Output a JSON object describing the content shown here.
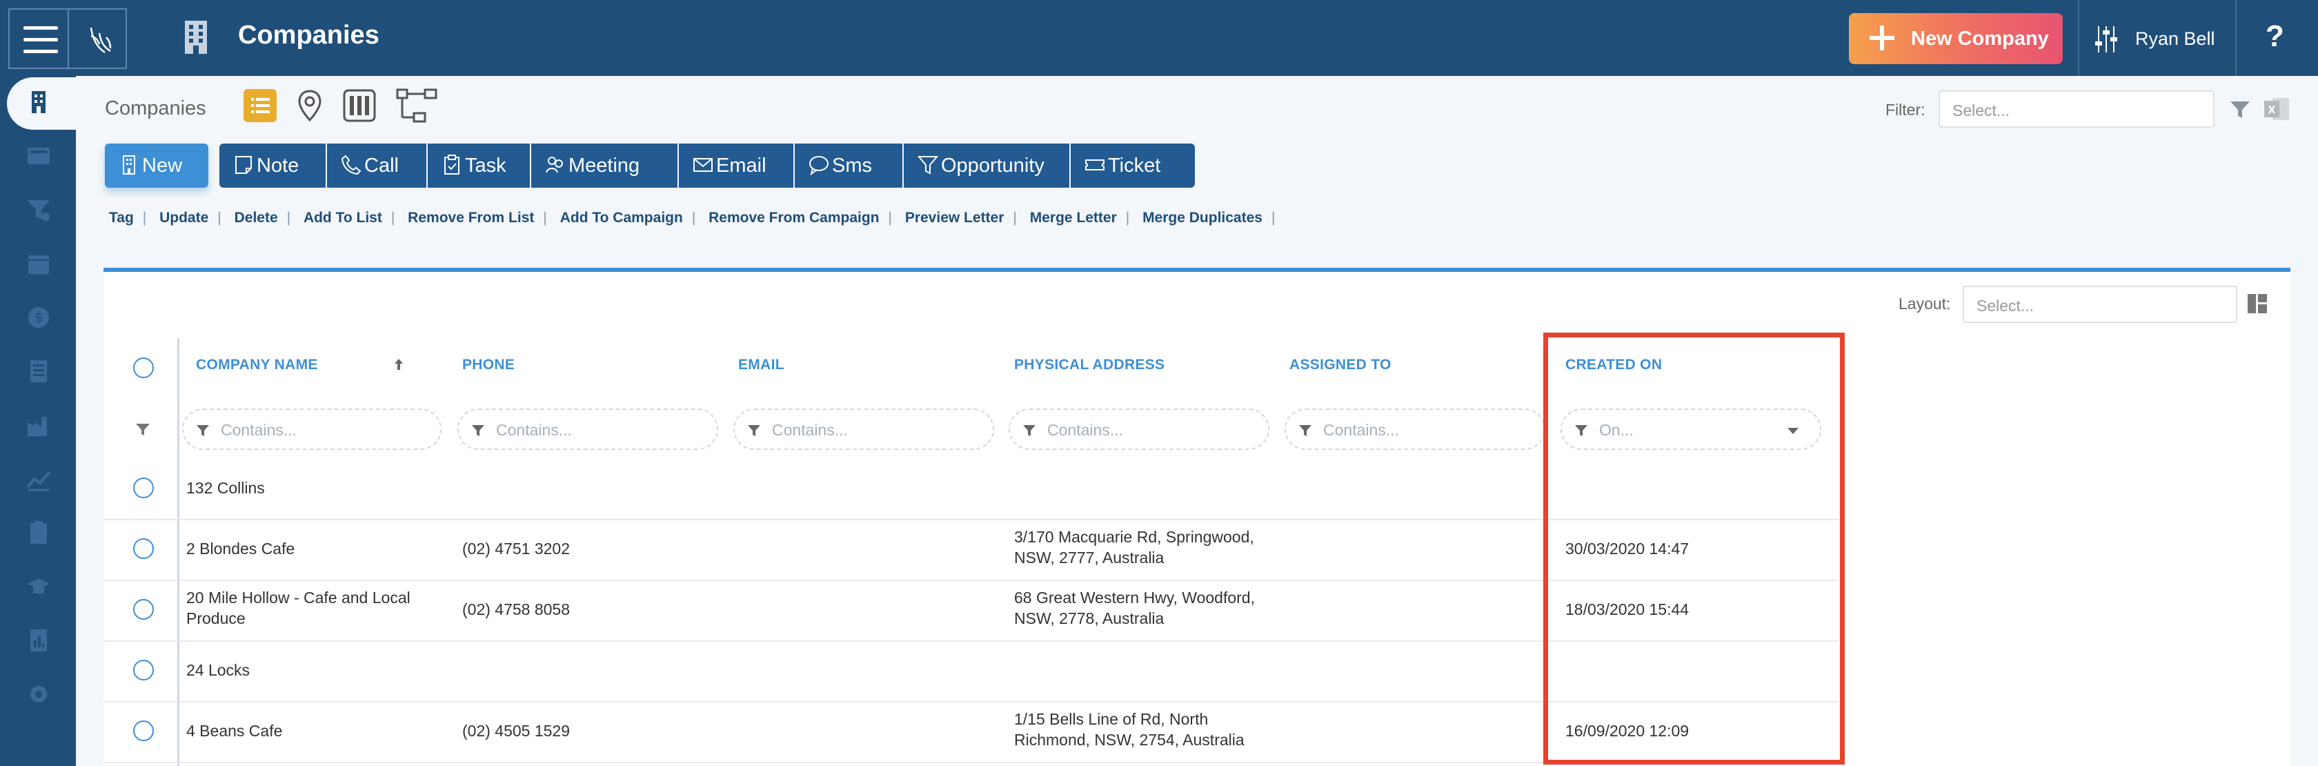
{
  "header": {
    "title": "Companies",
    "new_company_label": "New Company",
    "user_name": "Ryan Bell",
    "help_label": "?"
  },
  "toolbar": {
    "breadcrumb": "Companies",
    "filter_label": "Filter:",
    "filter_placeholder": "Select...",
    "views": [
      "list-view-icon",
      "map-pin-icon",
      "kanban-icon",
      "hierarchy-icon"
    ]
  },
  "actions": [
    {
      "label": "New",
      "icon": "building-icon"
    },
    {
      "label": "Note",
      "icon": "note-icon"
    },
    {
      "label": "Call",
      "icon": "phone-icon"
    },
    {
      "label": "Task",
      "icon": "clipboard-icon"
    },
    {
      "label": "Meeting",
      "icon": "people-icon"
    },
    {
      "label": "Email",
      "icon": "envelope-icon"
    },
    {
      "label": "Sms",
      "icon": "sms-icon"
    },
    {
      "label": "Opportunity",
      "icon": "funnel-icon"
    },
    {
      "label": "Ticket",
      "icon": "ticket-icon"
    }
  ],
  "links": [
    "Tag",
    "Update",
    "Delete",
    "Add To List",
    "Remove From List",
    "Add To Campaign",
    "Remove From Campaign",
    "Preview Letter",
    "Merge Letter",
    "Merge Duplicates"
  ],
  "grid": {
    "layout_label": "Layout:",
    "layout_placeholder": "Select...",
    "columns": [
      {
        "header": "COMPANY NAME",
        "filter": "Contains..."
      },
      {
        "header": "PHONE",
        "filter": "Contains..."
      },
      {
        "header": "EMAIL",
        "filter": "Contains..."
      },
      {
        "header": "PHYSICAL ADDRESS",
        "filter": "Contains..."
      },
      {
        "header": "ASSIGNED TO",
        "filter": "Contains..."
      },
      {
        "header": "CREATED ON",
        "filter": "On..."
      }
    ],
    "rows": [
      {
        "name": [
          "132 Collins"
        ],
        "phone": "",
        "email": "",
        "address": [],
        "assigned": "",
        "created": ""
      },
      {
        "name": [
          "2 Blondes Cafe"
        ],
        "phone": "(02) 4751 3202",
        "email": "",
        "address": [
          "3/170 Macquarie Rd, Springwood,",
          "NSW, 2777, Australia"
        ],
        "assigned": "",
        "created": "30/03/2020 14:47"
      },
      {
        "name": [
          "20 Mile Hollow - Cafe and Local",
          "Produce"
        ],
        "phone": "(02) 4758 8058",
        "email": "",
        "address": [
          "68 Great Western Hwy, Woodford,",
          "NSW, 2778, Australia"
        ],
        "assigned": "",
        "created": "18/03/2020 15:44"
      },
      {
        "name": [
          "24 Locks"
        ],
        "phone": "",
        "email": "",
        "address": [],
        "assigned": "",
        "created": ""
      },
      {
        "name": [
          "4 Beans Cafe"
        ],
        "phone": "(02) 4505 1529",
        "email": "",
        "address": [
          "1/15 Bells Line of Rd, North",
          "Richmond, NSW, 2754, Australia"
        ],
        "assigned": "",
        "created": "16/09/2020 12:09"
      }
    ]
  },
  "colors": {
    "topbar": "#1f4e79",
    "accent": "#3d8fd6",
    "highlight": "#e5432f",
    "view_active": "#e9ad2d"
  }
}
